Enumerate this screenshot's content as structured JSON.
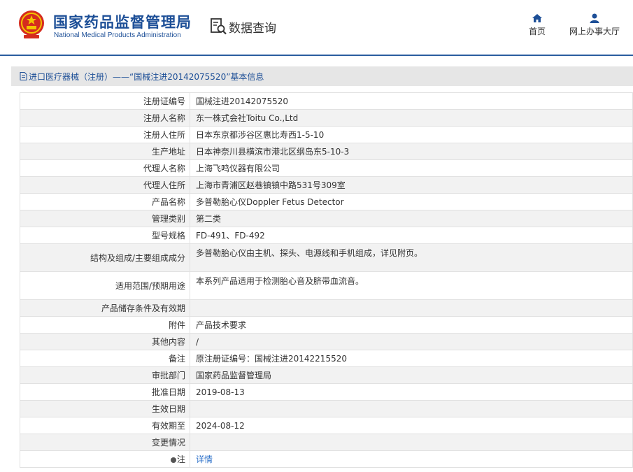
{
  "header": {
    "brand_cn": "国家药品监督管理局",
    "brand_en": "National Medical Products Administration",
    "query_label": "数据查询",
    "nav": [
      {
        "label": "首页",
        "icon": "home-icon"
      },
      {
        "label": "网上办事大厅",
        "icon": "user-icon"
      }
    ]
  },
  "breadcrumb": {
    "text": "进口医疗器械（注册）——“国械注进20142075520”基本信息",
    "icon": "document-icon"
  },
  "colors": {
    "brand_blue": "#1d4f97",
    "header_rule": "#2a5d9f",
    "link_blue": "#2a6fc9",
    "row_alt": "#f2f2f2"
  },
  "rows": [
    {
      "label": "注册证编号",
      "value": "国械注进20142075520"
    },
    {
      "label": "注册人名称",
      "value": "东一株式会社Toitu Co.,Ltd"
    },
    {
      "label": "注册人住所",
      "value": "日本东京都涉谷区惠比寿西1-5-10"
    },
    {
      "label": "生产地址",
      "value": "日本神奈川县横滨市港北区纲岛东5-10-3"
    },
    {
      "label": "代理人名称",
      "value": "上海飞鸣仪器有限公司"
    },
    {
      "label": "代理人住所",
      "value": "上海市青浦区赵巷镇镇中路531号309室"
    },
    {
      "label": "产品名称",
      "value": "多普勒胎心仪Doppler Fetus Detector"
    },
    {
      "label": "管理类别",
      "value": "第二类"
    },
    {
      "label": "型号规格",
      "value": "FD-491、FD-492"
    },
    {
      "label": "结构及组成/主要组成成分",
      "value": "多普勒胎心仪由主机、探头、电源线和手机组成，详见附页。"
    },
    {
      "label": "适用范围/预期用途",
      "value": "本系列产品适用于检测胎心音及脐带血流音。"
    },
    {
      "label": "产品储存条件及有效期",
      "value": ""
    },
    {
      "label": "附件",
      "value": "产品技术要求"
    },
    {
      "label": "其他内容",
      "value": "/"
    },
    {
      "label": "备注",
      "value": "原注册证编号：国械注进20142215520"
    },
    {
      "label": "审批部门",
      "value": "国家药品监督管理局"
    },
    {
      "label": "批准日期",
      "value": "2019-08-13"
    },
    {
      "label": "生效日期",
      "value": ""
    },
    {
      "label": "有效期至",
      "value": "2024-08-12"
    },
    {
      "label": "变更情况",
      "value": ""
    },
    {
      "label": "注",
      "value": "详情"
    }
  ]
}
